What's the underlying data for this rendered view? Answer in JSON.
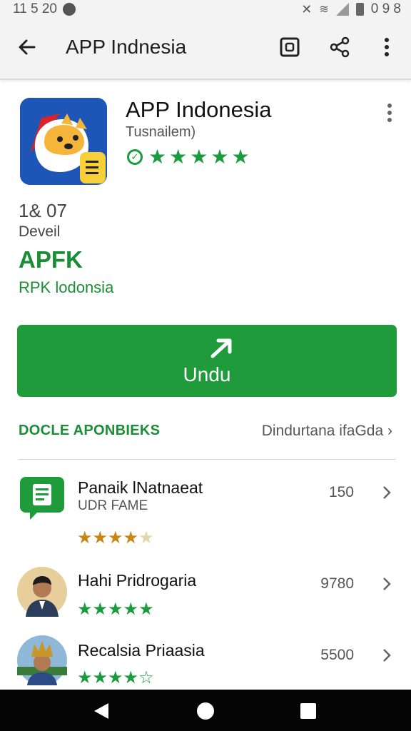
{
  "status_bar": {
    "time": "11 5 20",
    "battery_text": "0 9 8"
  },
  "app_bar": {
    "title": "APP Indnesia",
    "icons": [
      "back-arrow-icon",
      "screen-icon",
      "share-icon",
      "more-vert-icon"
    ]
  },
  "app": {
    "name": "APP Indonesia",
    "developer": "Tusnailem)",
    "rating_stars": 5,
    "stat_value": "1& 07",
    "stat_label": "Deveil",
    "apk_title": "APFK",
    "apk_subtitle": "RPK lodonsia",
    "install_label": "Undu"
  },
  "section": {
    "title": "DOCLE APONBIEKS",
    "link": "Dindurtana ifaGda"
  },
  "list": [
    {
      "name": "Panaik lNatnaeat",
      "subtitle": "UDR FAME",
      "count": "150",
      "stars": 4.5,
      "star_color": "#c88514"
    },
    {
      "name": "Hahi Pridrogaria",
      "subtitle": "",
      "count": "9780",
      "stars": 5,
      "star_color": "#1a9c3e"
    },
    {
      "name": "Recalsia Priaasia",
      "subtitle": "",
      "count": "5500",
      "stars": 4.5,
      "star_color": "#1a9c3e"
    }
  ],
  "colors": {
    "brand_green": "#1f9b3c",
    "text_green": "#1a8e35",
    "app_icon_bg": "#1e56b8"
  }
}
